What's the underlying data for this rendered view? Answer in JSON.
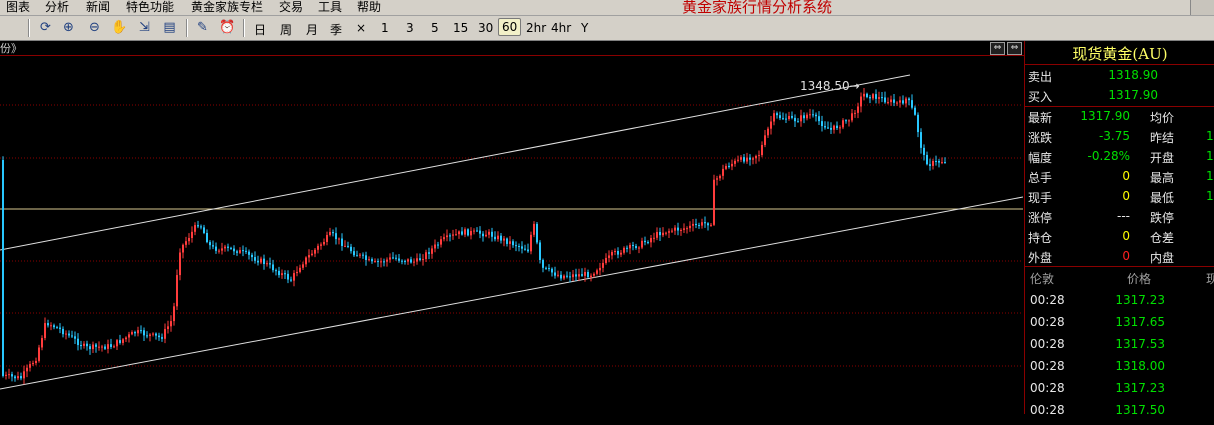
{
  "menu": [
    "图表",
    "分析",
    "新闻",
    "特色功能",
    "黄金家族专栏",
    "交易",
    "工具",
    "帮助"
  ],
  "app_title": "黄金家族行情分析系统",
  "toolbar_icons": [
    "refresh-icon",
    "zoom-in-icon",
    "zoom-out-icon",
    "hand-icon",
    "export-icon",
    "split-icon",
    "draw-icon",
    "alarm-icon"
  ],
  "periods": [
    "日",
    "周",
    "月",
    "季",
    "×",
    "1",
    "3",
    "5",
    "15",
    "30",
    "60",
    "2hr",
    "4hr",
    "Y"
  ],
  "active_period": "60",
  "chart": {
    "header_marker": "份》",
    "high_label": "1348.50→"
  },
  "panel": {
    "title": "现货黄金(AU)",
    "quotes": [
      {
        "label": "卖出",
        "value": "1318.90",
        "color": "#00e000"
      },
      {
        "label": "买入",
        "value": "1317.90",
        "color": "#00e000"
      }
    ],
    "stats": [
      {
        "label": "最新",
        "value": "1317.90",
        "color": "#00e000",
        "label2": "均价",
        "value2": ""
      },
      {
        "label": "涨跌",
        "value": "-3.75",
        "color": "#00e000",
        "label2": "昨结",
        "value2": "1"
      },
      {
        "label": "幅度",
        "value": "-0.28%",
        "color": "#00e000",
        "label2": "开盘",
        "value2": "1"
      },
      {
        "label": "总手",
        "value": "0",
        "color": "#ffff00",
        "label2": "最高",
        "value2": "1"
      },
      {
        "label": "现手",
        "value": "0",
        "color": "#ffff00",
        "label2": "最低",
        "value2": "1"
      },
      {
        "label": "涨停",
        "value": "---",
        "color": "#e8e8e8",
        "label2": "跌停",
        "value2": ""
      },
      {
        "label": "持仓",
        "value": "0",
        "color": "#ffff00",
        "label2": "仓差",
        "value2": ""
      },
      {
        "label": "外盘",
        "value": "0",
        "color": "#ff2020",
        "label2": "内盘",
        "value2": ""
      }
    ],
    "trades_header": {
      "time": "伦敦",
      "price": "价格",
      "vol": "现"
    },
    "trades": [
      {
        "time": "00:28",
        "price": "1317.23"
      },
      {
        "time": "00:28",
        "price": "1317.65"
      },
      {
        "time": "00:28",
        "price": "1317.53"
      },
      {
        "time": "00:28",
        "price": "1318.00"
      },
      {
        "time": "00:28",
        "price": "1317.23"
      },
      {
        "time": "00:28",
        "price": "1317.50"
      }
    ]
  },
  "colors": {
    "up": "#ff3c3c",
    "down": "#28c8ff",
    "trendline": "#e0e0e0",
    "gridline": "#8a0000"
  }
}
